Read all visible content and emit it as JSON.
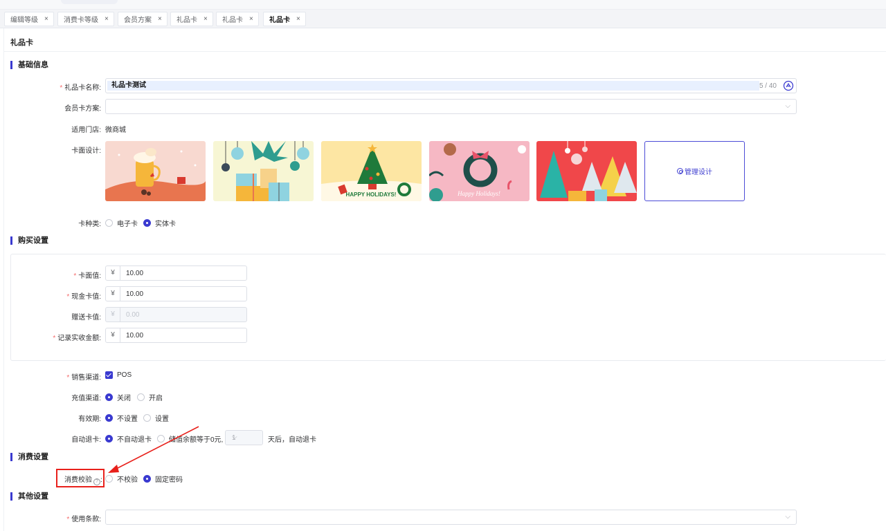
{
  "tabs": [
    {
      "label": "编辑等级",
      "close": "×"
    },
    {
      "label": "消费卡等级",
      "close": "×"
    },
    {
      "label": "会员方案",
      "close": "×"
    },
    {
      "label": "礼品卡",
      "close": "×"
    },
    {
      "label": "礼品卡",
      "close": "×"
    },
    {
      "label": "礼品卡",
      "close": "×",
      "active": true
    }
  ],
  "page": {
    "title": "礼品卡"
  },
  "basic": {
    "section": "基础信息",
    "req_mark": "*",
    "name_label": "礼品卡名称:",
    "name_value": "礼品卡测试",
    "name_count": "5 / 40",
    "plan_label": "会员卡方案:",
    "plan_value": "",
    "store_label": "适用门店:",
    "store_value": "微商城",
    "design_label": "卡面设计:",
    "manage_design": "管理设计",
    "happy_holidays_1": "HAPPY HOLIDAYS!",
    "happy_holidays_2": "Happy Holidays!",
    "type_label": "卡种类:",
    "type_options": [
      "电子卡",
      "实体卡"
    ],
    "type_selected": "实体卡"
  },
  "buy": {
    "section": "购买设置",
    "currency": "¥",
    "face_label": "卡面值:",
    "face_value": "10.00",
    "cash_label": "现金卡值:",
    "cash_value": "10.00",
    "gift_label": "赠送卡值:",
    "gift_value": "0.00",
    "record_label": "记录实收金额:",
    "record_value": "10.00",
    "channel_label": "销售渠道:",
    "channel_option": "POS",
    "recharge_label": "充值渠道:",
    "recharge_options": [
      "关闭",
      "开启"
    ],
    "recharge_selected": "关闭",
    "validity_label": "有效期:",
    "validity_options": [
      "不设置",
      "设置"
    ],
    "validity_selected": "不设置",
    "refund_label": "自动退卡:",
    "refund_option_1": "不自动退卡",
    "refund_option_2": "储值余额等于0元,",
    "refund_days": "1",
    "refund_suffix": "天后，自动退卡"
  },
  "consume": {
    "section": "消费设置",
    "verify_label": "消费校验",
    "help": "?",
    "verify_colon": ":",
    "verify_options": [
      "不校验",
      "固定密码"
    ],
    "verify_selected": "固定密码"
  },
  "other": {
    "section": "其他设置",
    "terms_label": "使用条款:",
    "terms_value": ""
  },
  "colors": {
    "accent": "#3a3ad0",
    "required": "#f56c6c",
    "annotation": "#e8201b"
  }
}
